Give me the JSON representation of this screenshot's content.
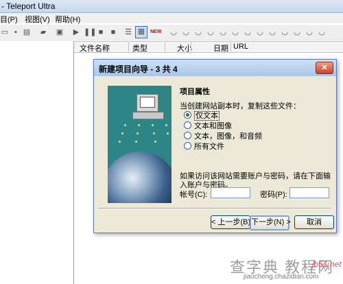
{
  "app": {
    "title": "- Teleport Ultra"
  },
  "menu": {
    "items": [
      "目(P)",
      "视图(V)",
      "帮助(H)"
    ]
  },
  "list": {
    "columns": [
      "文件名称",
      "类型",
      "大小",
      "日期",
      "URL"
    ]
  },
  "dialog": {
    "title": "新建项目向导 - 3 共 4",
    "close_label": "✕",
    "heading": "项目属性",
    "prompt": "当创建网站副本时，复制这些文件：",
    "options": [
      {
        "label": "仅文本",
        "selected": true
      },
      {
        "label": "文本和图像",
        "selected": false
      },
      {
        "label": "文本，图像，和音频",
        "selected": false
      },
      {
        "label": "所有文件",
        "selected": false
      }
    ],
    "description": "如果访问该网站需要账户与密码，请在下面输入账户与密码。",
    "account_label": "帐号(C):",
    "account_value": "",
    "password_label": "密码(P):",
    "password_value": "",
    "back_label": "< 上一步(B)",
    "next_label": "下一步(N) >",
    "cancel_label": "取消"
  },
  "watermark": {
    "text": "查字典 教程网",
    "site": "jb51.net",
    "url": "jiaocheng.chazidian.com"
  },
  "colors": {
    "accent": "#3d6fb3",
    "dialog_bg": "#ece9d8",
    "art_bg": "#2e8585"
  }
}
